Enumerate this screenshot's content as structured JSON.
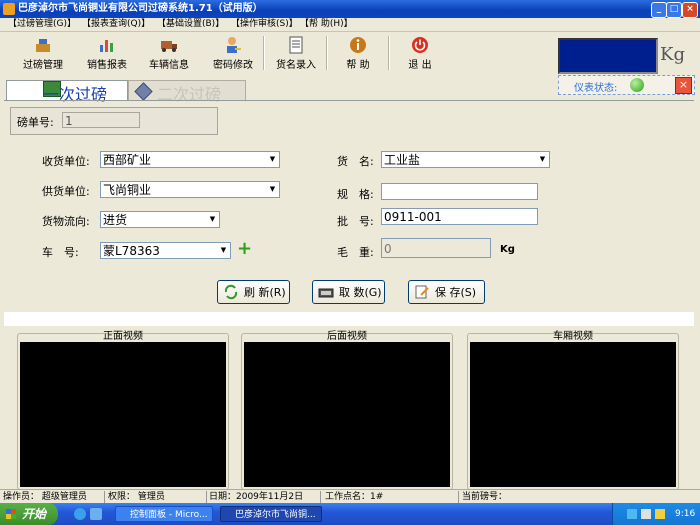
{
  "window": {
    "title": "巴彦淖尔市飞尚铜业有限公司过磅系统1.71（试用版）"
  },
  "menu": [
    "【过磅管理(G)】",
    "【报表查询(Q)】",
    "【基础设置(B)】",
    "【操作审核(S)】",
    "【帮 助(H)】"
  ],
  "toolbar": [
    {
      "label": "过磅管理",
      "icon": "scale-icon"
    },
    {
      "label": "销售报表",
      "icon": "bar-chart-icon"
    },
    {
      "label": "车辆信息",
      "icon": "truck-icon"
    },
    {
      "label": "密码修改",
      "icon": "user-key-icon"
    },
    {
      "label": "货名录入",
      "icon": "document-icon"
    },
    {
      "label": "帮  助",
      "icon": "info-icon"
    },
    {
      "label": "退  出",
      "icon": "power-icon"
    }
  ],
  "weight_unit": "Kg",
  "instrument": {
    "label": "仪表状态:",
    "led_color": "#2ea018"
  },
  "tabs": [
    "一次过磅",
    "二次过磅"
  ],
  "form": {
    "bill_label": "磅单号:",
    "bill_value": "1",
    "receiver_label": "收货单位:",
    "receiver_value": "西部矿业",
    "supplier_label": "供货单位:",
    "supplier_value": "飞尚铜业",
    "flow_label": "货物流向:",
    "flow_value": "进货",
    "plate_label": "车　号:",
    "plate_value": "蒙L78363",
    "goods_label": "货　名:",
    "goods_value": "工业盐",
    "spec_label": "规　格:",
    "spec_value": "",
    "batch_label": "批　号:",
    "batch_value": "0911-001",
    "gross_label": "毛　重:",
    "gross_value": "0",
    "gross_unit": "Kg"
  },
  "actions": {
    "refresh": "刷 新(R)",
    "fetch": "取 数(G)",
    "save": "保 存(S)"
  },
  "videos": [
    "正面视频",
    "后面视频",
    "车厢视频"
  ],
  "statusbar": {
    "operator": "操作员： 超级管理员",
    "permission": "权限： 管理员",
    "date": "日期：2009年11月2日",
    "station": "工作点名：1#",
    "current_bill": "当前磅号："
  },
  "taskbar": {
    "start": "开始",
    "task1": "控制面板 - Micro...",
    "task2": "巴彦淖尔市飞尚铜...",
    "clock": "9:16"
  }
}
